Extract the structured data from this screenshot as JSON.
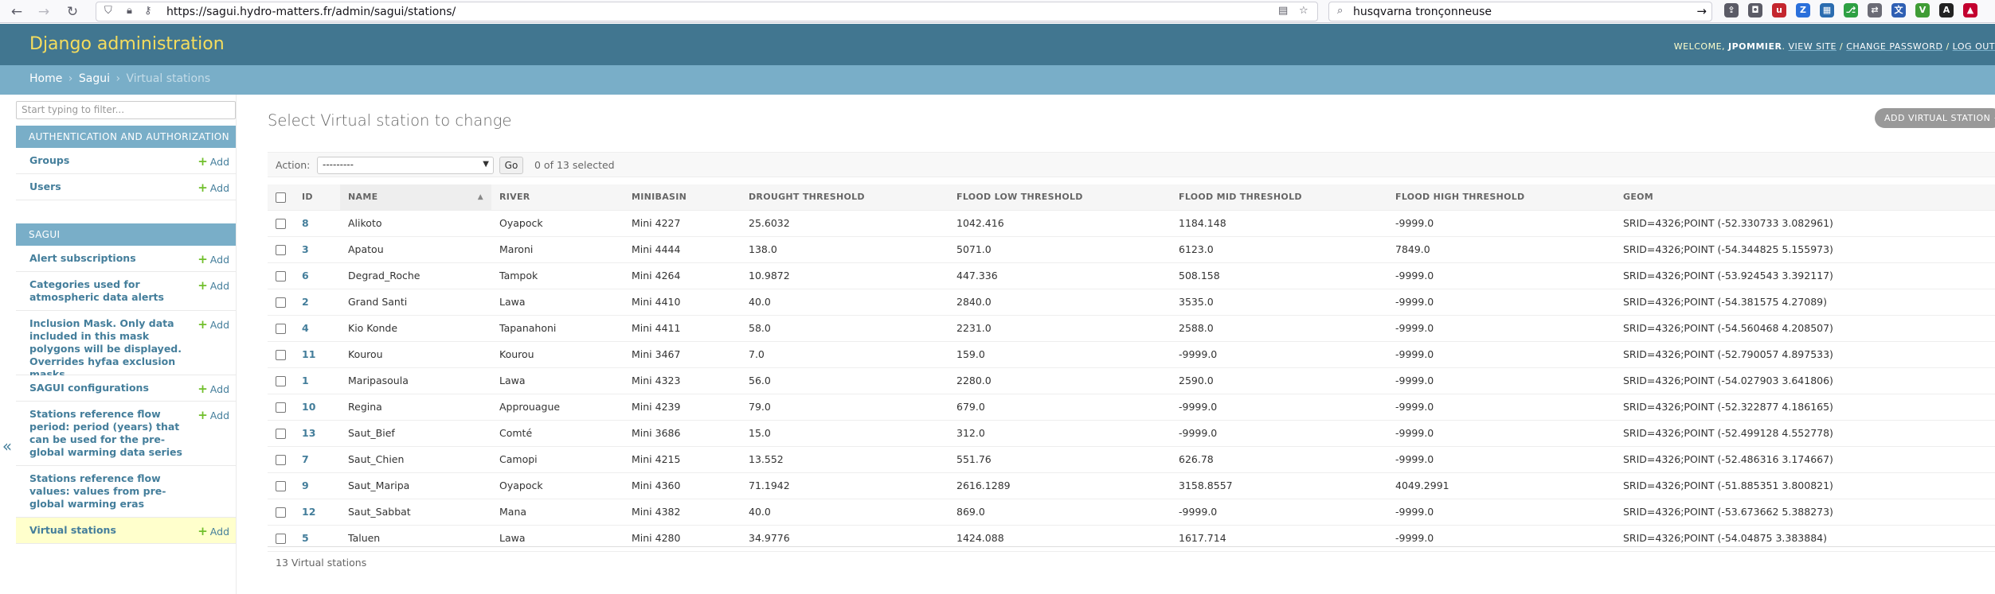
{
  "browser": {
    "url": "https://sagui.hydro-matters.fr/admin/sagui/stations/",
    "search_query": "husqvarna tronçonneuse"
  },
  "header": {
    "branding": "Django administration",
    "welcome": "WELCOME,",
    "username": "JPOMMIER",
    "view_site": "VIEW SITE",
    "change_password": "CHANGE PASSWORD",
    "logout": "LOG OUT",
    "divider": " / "
  },
  "breadcrumbs": {
    "home": "Home",
    "separator": "›",
    "app": "Sagui",
    "current": "Virtual stations"
  },
  "sidebar": {
    "filter_placeholder": "Start typing to filter...",
    "add_label": "Add",
    "modules": [
      {
        "caption": "AUTHENTICATION AND AUTHORIZATION",
        "models": [
          {
            "label": "Groups"
          },
          {
            "label": "Users"
          }
        ]
      },
      {
        "caption": "SAGUI",
        "models": [
          {
            "label": "Alert subscriptions"
          },
          {
            "label": "Categories used for atmospheric data alerts"
          },
          {
            "label": "Inclusion Mask. Only data included in this mask polygons will be displayed. Overrides hyfaa exclusion masks"
          },
          {
            "label": "SAGUI configurations"
          },
          {
            "label": "Stations reference flow period: period (years) that can be used for the pre-global warming data series"
          },
          {
            "label": "Stations reference flow values: values from pre-global warming eras"
          },
          {
            "label": "Virtual stations"
          }
        ]
      }
    ],
    "collapse_glyph": "«"
  },
  "content": {
    "title": "Select Virtual station to change",
    "add_button": "ADD VIRTUAL STATION",
    "action_label": "Action:",
    "action_selected": "---------",
    "go_label": "Go",
    "selection_counter": "0 of 13 selected",
    "footer_count": "13 Virtual stations"
  },
  "table": {
    "columns": [
      "ID",
      "NAME",
      "RIVER",
      "MINIBASIN",
      "DROUGHT THRESHOLD",
      "FLOOD LOW THRESHOLD",
      "FLOOD MID THRESHOLD",
      "FLOOD HIGH THRESHOLD",
      "GEOM"
    ],
    "rows": [
      [
        "8",
        "Alikoto",
        "Oyapock",
        "Mini 4227",
        "25.6032",
        "1042.416",
        "1184.148",
        "-9999.0",
        "SRID=4326;POINT (-52.330733 3.082961)"
      ],
      [
        "3",
        "Apatou",
        "Maroni",
        "Mini 4444",
        "138.0",
        "5071.0",
        "6123.0",
        "7849.0",
        "SRID=4326;POINT (-54.344825 5.155973)"
      ],
      [
        "6",
        "Degrad_Roche",
        "Tampok",
        "Mini 4264",
        "10.9872",
        "447.336",
        "508.158",
        "-9999.0",
        "SRID=4326;POINT (-53.924543 3.392117)"
      ],
      [
        "2",
        "Grand Santi",
        "Lawa",
        "Mini 4410",
        "40.0",
        "2840.0",
        "3535.0",
        "-9999.0",
        "SRID=4326;POINT (-54.381575 4.27089)"
      ],
      [
        "4",
        "Kio Konde",
        "Tapanahoni",
        "Mini 4411",
        "58.0",
        "2231.0",
        "2588.0",
        "-9999.0",
        "SRID=4326;POINT (-54.560468 4.208507)"
      ],
      [
        "11",
        "Kourou",
        "Kourou",
        "Mini 3467",
        "7.0",
        "159.0",
        "-9999.0",
        "-9999.0",
        "SRID=4326;POINT (-52.790057 4.897533)"
      ],
      [
        "1",
        "Maripasoula",
        "Lawa",
        "Mini 4323",
        "56.0",
        "2280.0",
        "2590.0",
        "-9999.0",
        "SRID=4326;POINT (-54.027903 3.641806)"
      ],
      [
        "10",
        "Regina",
        "Approuague",
        "Mini 4239",
        "79.0",
        "679.0",
        "-9999.0",
        "-9999.0",
        "SRID=4326;POINT (-52.322877 4.186165)"
      ],
      [
        "13",
        "Saut_Bief",
        "Comté",
        "Mini 3686",
        "15.0",
        "312.0",
        "-9999.0",
        "-9999.0",
        "SRID=4326;POINT (-52.499128 4.552778)"
      ],
      [
        "7",
        "Saut_Chien",
        "Camopi",
        "Mini 4215",
        "13.552",
        "551.76",
        "626.78",
        "-9999.0",
        "SRID=4326;POINT (-52.486316 3.174667)"
      ],
      [
        "9",
        "Saut_Maripa",
        "Oyapock",
        "Mini 4360",
        "71.1942",
        "2616.1289",
        "3158.8557",
        "4049.2991",
        "SRID=4326;POINT (-51.885351 3.800821)"
      ],
      [
        "12",
        "Saut_Sabbat",
        "Mana",
        "Mini 4382",
        "40.0",
        "869.0",
        "-9999.0",
        "-9999.0",
        "SRID=4326;POINT (-53.673662 5.388273)"
      ],
      [
        "5",
        "Taluen",
        "Lawa",
        "Mini 4280",
        "34.9776",
        "1424.088",
        "1617.714",
        "-9999.0",
        "SRID=4326;POINT (-54.04875 3.383884)"
      ]
    ]
  }
}
